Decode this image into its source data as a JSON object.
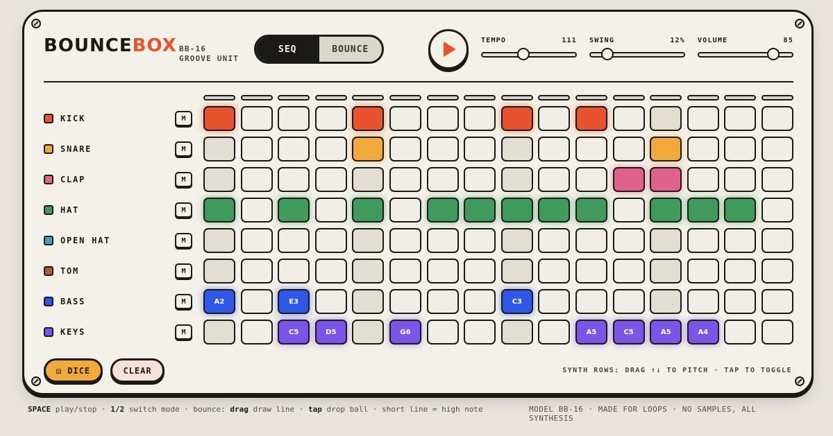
{
  "brand": {
    "logo_part1": "BOUNCE",
    "logo_part2": "BOX",
    "model_line1": "BB-16",
    "model_line2": "GROOVE UNIT"
  },
  "mode": {
    "seq_label": "SEQ",
    "bounce_label": "BOUNCE",
    "active": "SEQ"
  },
  "transport": {
    "play_icon": "play-icon"
  },
  "sliders": [
    {
      "id": "tempo",
      "label": "TEMPO",
      "value": "111",
      "level": 0.44
    },
    {
      "id": "swing",
      "label": "SWING",
      "value": "12%",
      "level": 0.18
    },
    {
      "id": "volume",
      "label": "VOLUME",
      "value": "85",
      "level": 0.8
    }
  ],
  "colors": {
    "kick": "#e8532f",
    "snare": "#f2a93b",
    "clap": "#e0628c",
    "hat": "#3f9a5c",
    "open_hat": "#3aa5c3",
    "tom": "#b4592f",
    "bass": "#2f58e8",
    "keys": "#7a55e8"
  },
  "tracks": [
    {
      "id": "kick",
      "label": "KICK",
      "color": "#e8532f",
      "mute": "M",
      "steps": [
        1,
        0,
        0,
        0,
        1,
        0,
        0,
        0,
        1,
        0,
        1,
        0,
        0,
        0,
        0,
        0
      ],
      "notes": []
    },
    {
      "id": "snare",
      "label": "SNARE",
      "color": "#f2a93b",
      "mute": "M",
      "steps": [
        0,
        0,
        0,
        0,
        1,
        0,
        0,
        0,
        0,
        0,
        0,
        0,
        1,
        0,
        0,
        0
      ],
      "notes": []
    },
    {
      "id": "clap",
      "label": "CLAP",
      "color": "#e0628c",
      "mute": "M",
      "steps": [
        0,
        0,
        0,
        0,
        0,
        0,
        0,
        0,
        0,
        0,
        0,
        1,
        1,
        0,
        0,
        0
      ],
      "notes": []
    },
    {
      "id": "hat",
      "label": "HAT",
      "color": "#3f9a5c",
      "mute": "M",
      "steps": [
        1,
        0,
        1,
        0,
        1,
        0,
        1,
        1,
        1,
        1,
        1,
        0,
        1,
        1,
        1,
        0
      ],
      "notes": []
    },
    {
      "id": "open_hat",
      "label": "OPEN HAT",
      "color": "#3aa5c3",
      "mute": "M",
      "steps": [
        0,
        0,
        0,
        0,
        0,
        0,
        0,
        0,
        0,
        0,
        0,
        0,
        0,
        0,
        0,
        0
      ],
      "notes": []
    },
    {
      "id": "tom",
      "label": "TOM",
      "color": "#b4592f",
      "mute": "M",
      "steps": [
        0,
        0,
        0,
        0,
        0,
        0,
        0,
        0,
        0,
        0,
        0,
        0,
        0,
        0,
        0,
        0
      ],
      "notes": []
    },
    {
      "id": "bass",
      "label": "BASS",
      "color": "#2f58e8",
      "mute": "M",
      "steps": [
        1,
        0,
        1,
        0,
        0,
        0,
        0,
        0,
        1,
        0,
        0,
        0,
        0,
        0,
        0,
        0
      ],
      "notes": [
        "A2",
        "",
        "E3",
        "",
        "",
        "",
        "",
        "",
        "C3",
        "",
        "",
        "",
        "",
        "",
        "",
        ""
      ]
    },
    {
      "id": "keys",
      "label": "KEYS",
      "color": "#7a55e8",
      "mute": "M",
      "steps": [
        0,
        0,
        1,
        1,
        0,
        1,
        0,
        0,
        0,
        0,
        1,
        1,
        1,
        1,
        0,
        0
      ],
      "notes": [
        "",
        "",
        "C5",
        "D5",
        "",
        "G6",
        "",
        "",
        "",
        "",
        "A5",
        "C5",
        "A5",
        "A4",
        "",
        ""
      ]
    }
  ],
  "actions": {
    "dice_label": "⚄ DICE",
    "clear_label": "CLEAR"
  },
  "hint": "SYNTH ROWS: DRAG ↑↓ TO PITCH · TAP TO TOGGLE",
  "footer": {
    "k1": "SPACE",
    "t1": " play/stop · ",
    "k2": "1/2",
    "t2": " switch mode · bounce: ",
    "k3": "drag",
    "t3": " draw line · ",
    "k4": "tap",
    "t4": " drop ball · short line = high note",
    "right": "MODEL BB-16 · MADE FOR LOOPS · NO SAMPLES, ALL SYNTHESIS"
  }
}
